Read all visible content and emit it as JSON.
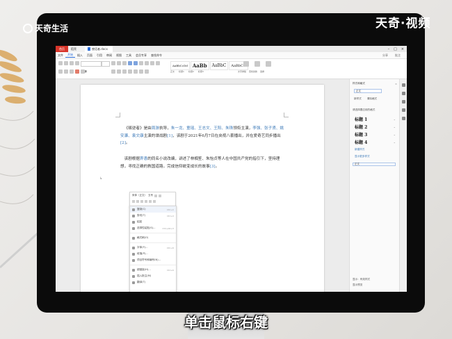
{
  "brand": {
    "top_left": "天奇生活",
    "top_right": "天奇·视频"
  },
  "caption": "单击鼠标右键",
  "wps": {
    "tabs": {
      "home": "首页",
      "templates": "稻壳",
      "document": "夜话者.docx"
    },
    "menu": [
      "文件",
      "开始",
      "插入",
      "页面",
      "引用",
      "审阅",
      "视图",
      "工具",
      "会员专享",
      "查找命令"
    ],
    "menu_selected_index": 1,
    "menu_right": [
      "分享",
      "批注"
    ],
    "ribbon": {
      "font_name": "宋体",
      "styles": [
        "AaBbCcDd",
        "AaBb",
        "AaBbC",
        "AaBbCcI"
      ],
      "style_labels": [
        "正文",
        "标题1",
        "标题2",
        "标题3"
      ],
      "right_labels": [
        "文字排版",
        "查找替换",
        "选择"
      ]
    }
  },
  "document": {
    "p1": {
      "text_a": "《叛逆者》是由",
      "hl_a": "周游",
      "text_b": "执导，",
      "hl_b": "朱一龙、童瑶、王志文、王阳、朱珠",
      "text_c": "领衔主演，",
      "hl_c": "李强、张子贤、姚安濂、袁文康",
      "text_d": "主演的谍战剧",
      "ref1": "[1]",
      "text_e": "，该剧于2021年6月7日在央视八套播出，并在爱奇艺同步播出",
      "ref2": "[2]",
      "text_f": "。"
    },
    "p2": {
      "text_a": "该剧根据",
      "hl_a": "畀愚",
      "text_b": "的同名小说改编，讲述了林楠笙、朱怡贞等人在中国共产党的指引下，坚持理想，寻找正确的救国道路，完成信仰蜕变成长的故事",
      "ref1": "[3]",
      "text_c": "。"
    },
    "cursor_mark": "↳"
  },
  "mini_toolbar": {
    "font": "宋体（正文）",
    "size": "五号"
  },
  "context_menu": [
    {
      "label": "复制(C)",
      "shortcut": "Ctrl+C"
    },
    {
      "label": "剪切(T)",
      "shortcut": "Ctrl+X"
    },
    {
      "label": "粘贴",
      "shortcut": ""
    },
    {
      "label": "选择性粘贴(S)...",
      "shortcut": "Ctrl+Alt+V"
    },
    {
      "label": "格式刷(O)",
      "shortcut": ""
    },
    {
      "label": "字体(F)...",
      "shortcut": "Ctrl+D"
    },
    {
      "label": "段落(P)...",
      "shortcut": ""
    },
    {
      "label": "项目符号和编号(N)...",
      "shortcut": ""
    },
    {
      "label": "超链接(H)...",
      "shortcut": "Ctrl+K"
    },
    {
      "label": "插入批注(M)",
      "shortcut": ""
    },
    {
      "label": "翻译(T)",
      "shortcut": ""
    }
  ],
  "style_pane": {
    "title": "样式和格式",
    "current_style": "正文",
    "btn_new": "新样式",
    "btn_clear": "清除格式",
    "subtitle": "请选择要应用的格式",
    "styles": [
      "标题 1",
      "标题 2",
      "标题 3",
      "标题 4"
    ],
    "link_body": "新建样式",
    "link_more": "显示更多样式",
    "body_style": "正文",
    "foot_a": "显示：有效样式",
    "foot_b": "显示预览"
  }
}
